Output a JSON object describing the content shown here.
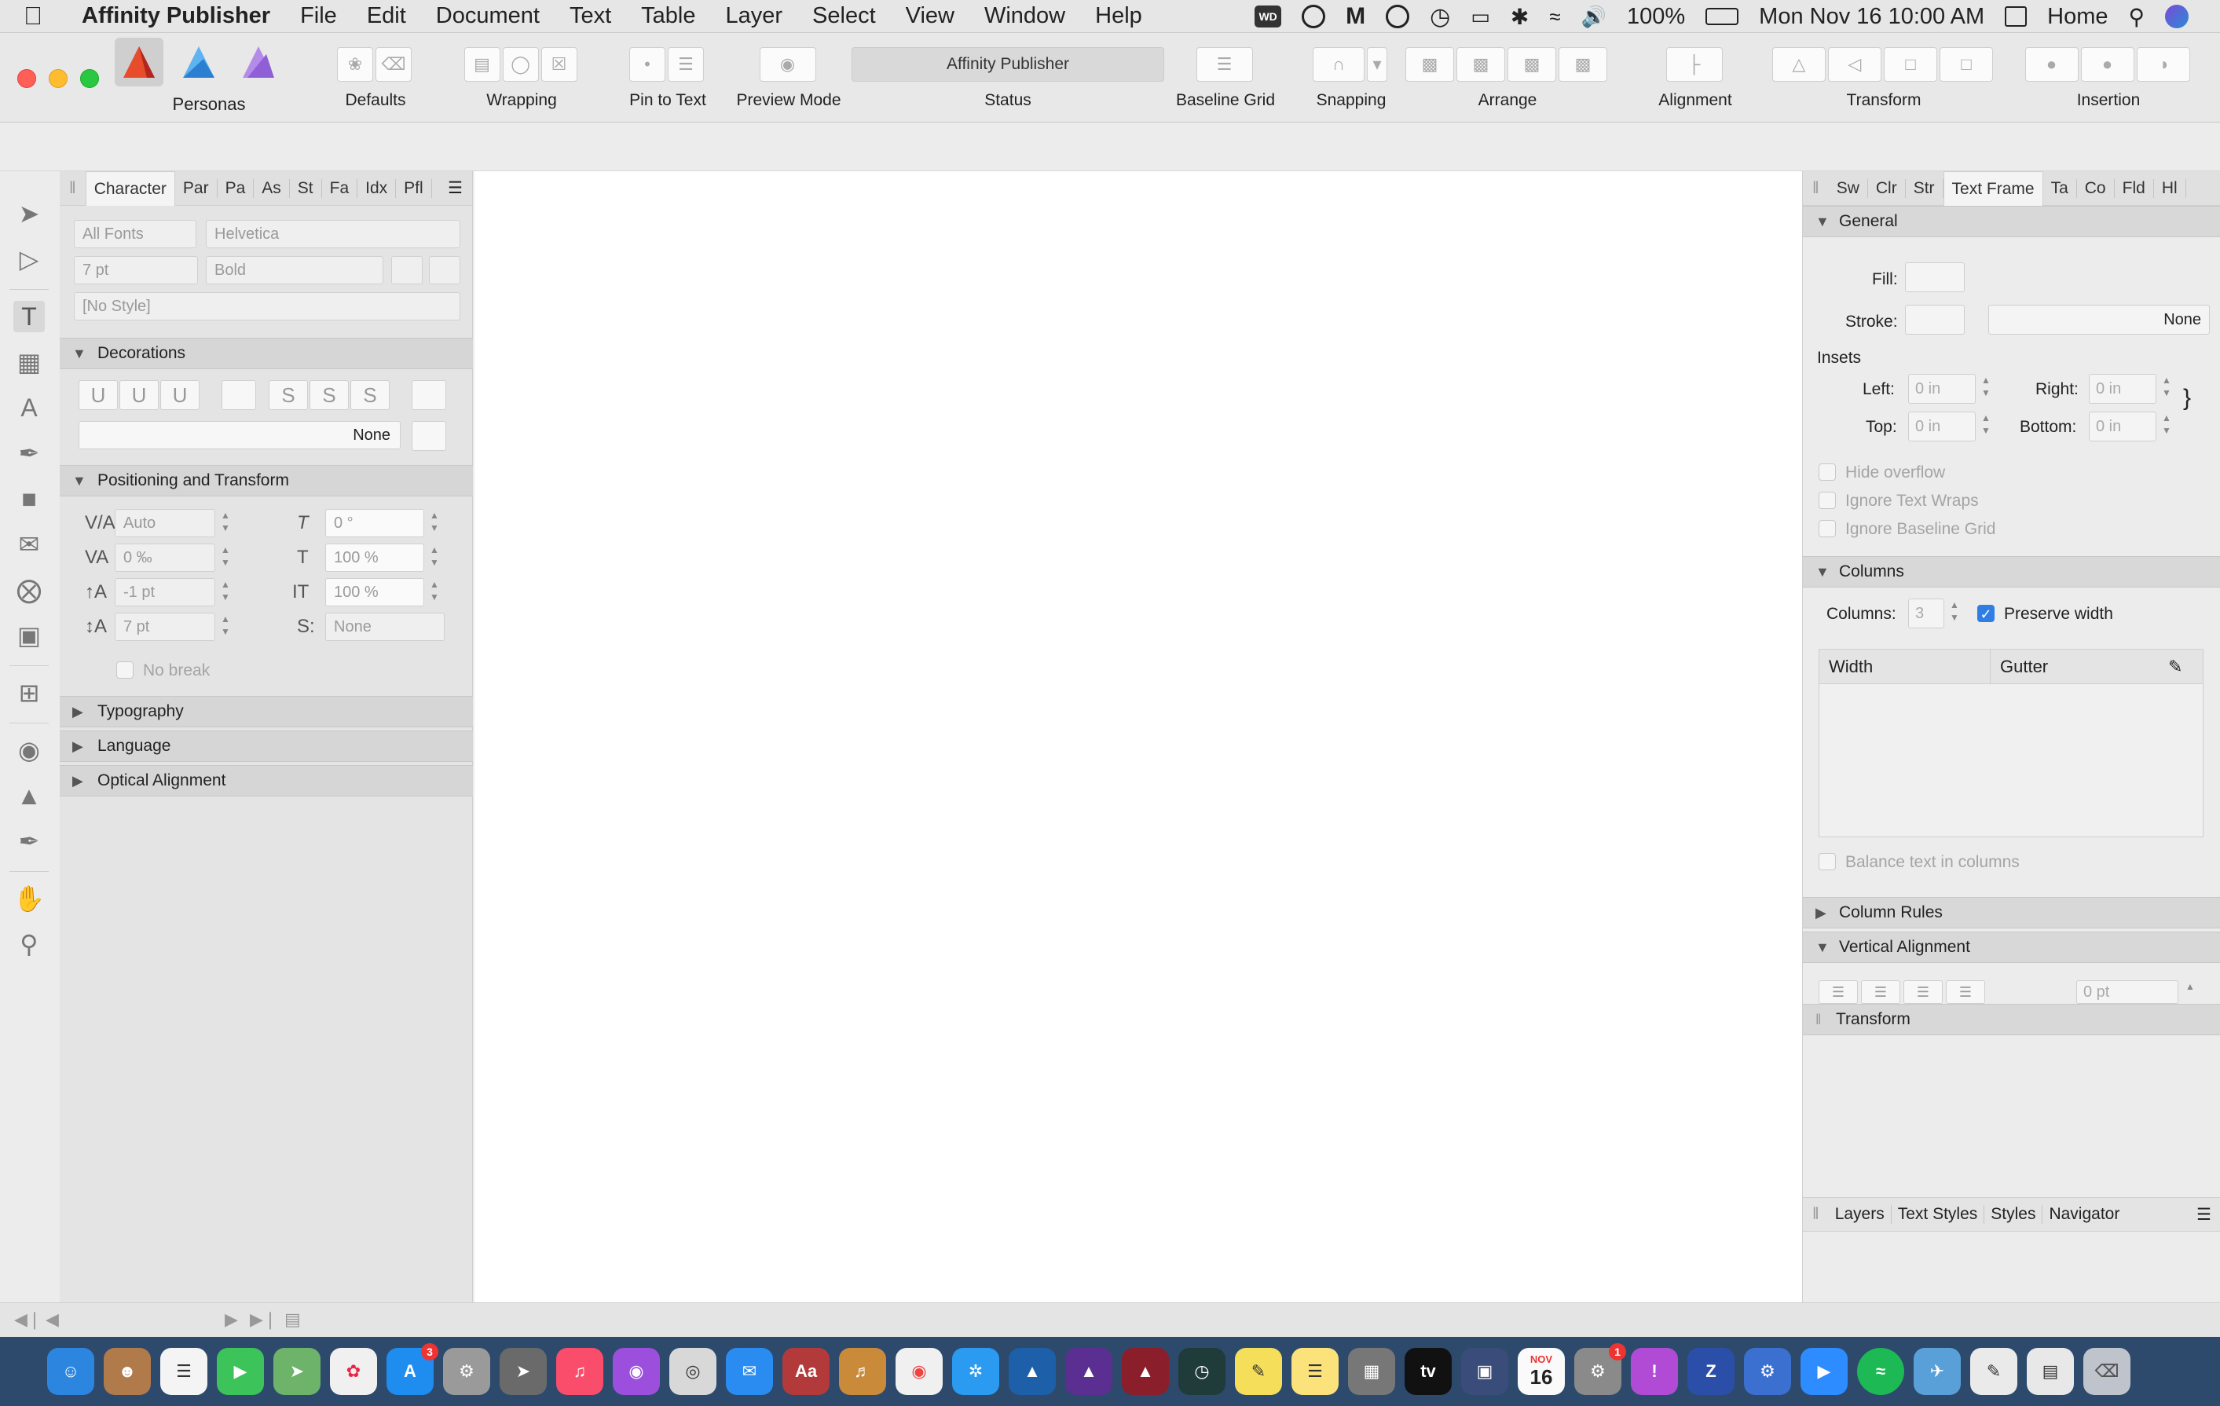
{
  "menubar": {
    "app_name": "Affinity Publisher",
    "items": [
      "File",
      "Edit",
      "Document",
      "Text",
      "Table",
      "Layer",
      "Select",
      "View",
      "Window",
      "Help"
    ],
    "wd_label": "WD",
    "battery": "100%",
    "datetime": "Mon Nov 16  10:00 AM",
    "home_label": "Home"
  },
  "toolbar": {
    "personas_label": "Personas",
    "groups": {
      "defaults": "Defaults",
      "wrapping": "Wrapping",
      "pin_to_text": "Pin to Text",
      "preview_mode": "Preview Mode",
      "status": "Status",
      "baseline_grid": "Baseline Grid",
      "snapping": "Snapping",
      "arrange": "Arrange",
      "alignment": "Alignment",
      "transform": "Transform",
      "insertion": "Insertion"
    },
    "status_text": "Affinity Publisher"
  },
  "left_panel": {
    "tabs": [
      "Character",
      "Par",
      "Pa",
      "As",
      "St",
      "Fa",
      "Idx",
      "Pfl"
    ],
    "active_tab": "Character",
    "font_collection": "All Fonts",
    "font_family": "Helvetica",
    "font_size": "7 pt",
    "font_weight": "Bold",
    "style": "[No Style]",
    "decorations": {
      "title": "Decorations",
      "none_label": "None"
    },
    "positioning": {
      "title": "Positioning and Transform",
      "kerning": "Auto",
      "tracking": "0 ‰",
      "baseline_shift": "-1 pt",
      "leading": "7 pt",
      "skew": "0 °",
      "horizontal_scale": "100 %",
      "vertical_scale": "100 %",
      "position": "None",
      "no_break": "No break"
    },
    "collapsed_sections": [
      "Typography",
      "Language",
      "Optical Alignment"
    ]
  },
  "right_panel": {
    "tabs": [
      "Sw",
      "Clr",
      "Str",
      "Text Frame",
      "Ta",
      "Co",
      "Fld",
      "Hl"
    ],
    "active_tab": "Text Frame",
    "general": {
      "title": "General",
      "fill_label": "Fill:",
      "stroke_label": "Stroke:",
      "stroke_value": "None",
      "insets_label": "Insets",
      "left_label": "Left:",
      "left_value": "0 in",
      "right_label": "Right:",
      "right_value": "0 in",
      "top_label": "Top:",
      "top_value": "0 in",
      "bottom_label": "Bottom:",
      "bottom_value": "0 in",
      "hide_overflow": "Hide overflow",
      "ignore_text_wraps": "Ignore Text Wraps",
      "ignore_baseline_grid": "Ignore Baseline Grid"
    },
    "columns": {
      "title": "Columns",
      "columns_label": "Columns:",
      "columns_value": "3",
      "preserve_width": "Preserve width",
      "width_header": "Width",
      "gutter_header": "Gutter",
      "balance_text": "Balance text in columns"
    },
    "column_rules": "Column Rules",
    "vertical_alignment": {
      "title": "Vertical Alignment",
      "value": "0 pt"
    },
    "transform_title": "Transform",
    "bottom_tabs": [
      "Layers",
      "Text Styles",
      "Styles",
      "Navigator"
    ]
  },
  "dock": {
    "calendar_month": "NOV",
    "calendar_day": "16",
    "badge_appstore": "3",
    "badge_prefs": "1"
  }
}
